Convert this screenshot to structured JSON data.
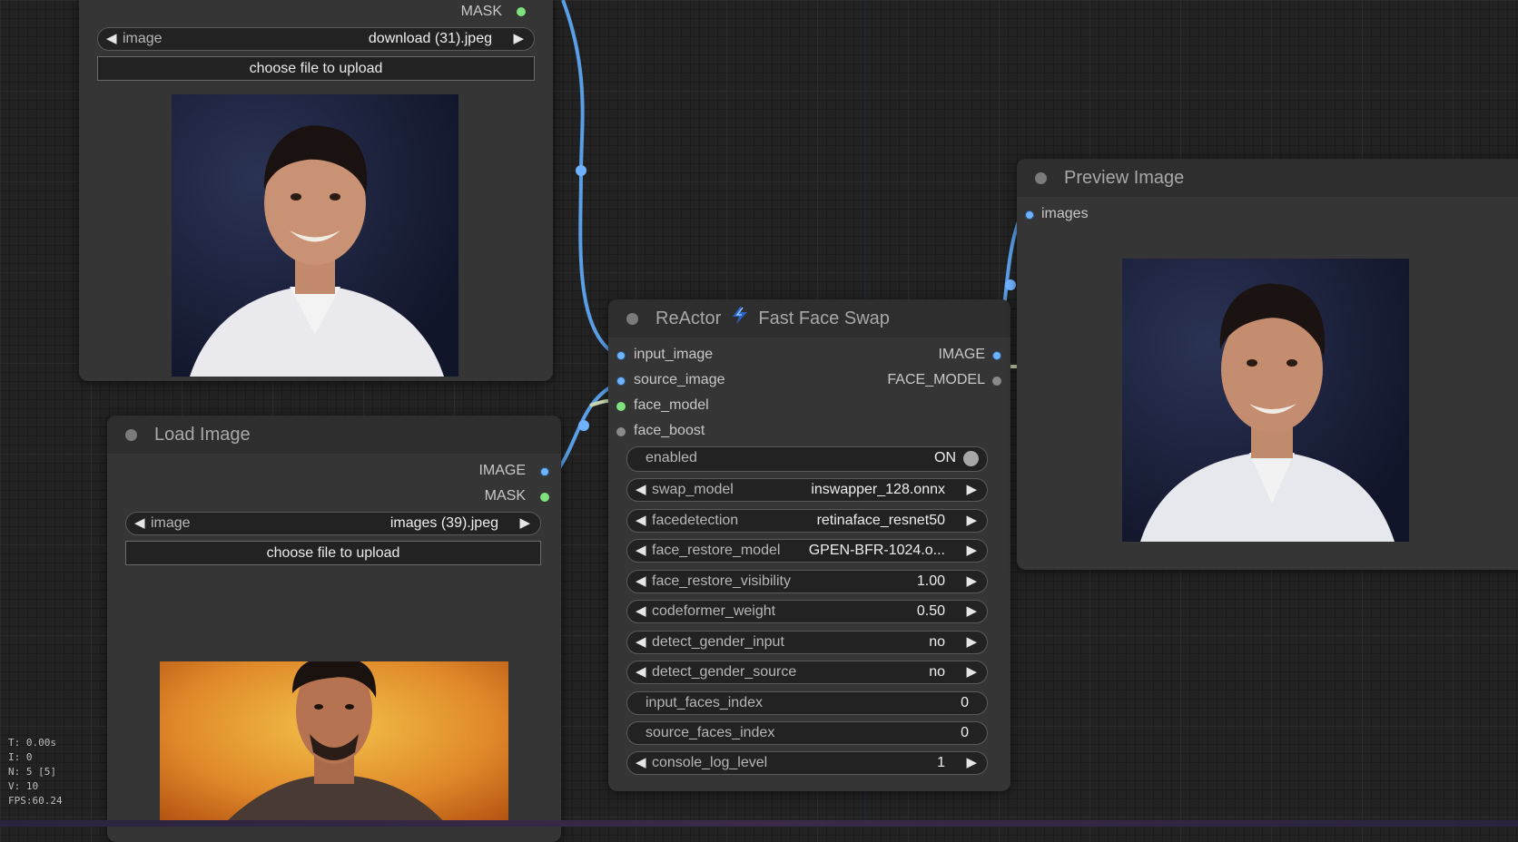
{
  "top_node": {
    "output_mask": "MASK",
    "image_widget": {
      "name": "image",
      "value": "download (31).jpeg"
    },
    "upload_label": "choose file to upload"
  },
  "load_node": {
    "title": "Load Image",
    "outputs": [
      "IMAGE",
      "MASK"
    ],
    "image_widget": {
      "name": "image",
      "value": "images (39).jpeg"
    },
    "upload_label": "choose file to upload"
  },
  "reactor_node": {
    "title_left": "ReActor",
    "title_right": "Fast Face Swap",
    "inputs": [
      "input_image",
      "source_image",
      "face_model",
      "face_boost"
    ],
    "outputs": [
      "IMAGE",
      "FACE_MODEL"
    ],
    "toggle": {
      "name": "enabled",
      "value": "ON"
    },
    "widgets": [
      {
        "name": "swap_model",
        "value": "inswapper_128.onnx"
      },
      {
        "name": "facedetection",
        "value": "retinaface_resnet50"
      },
      {
        "name": "face_restore_model",
        "value": "GPEN-BFR-1024.o..."
      },
      {
        "name": "face_restore_visibility",
        "value": "1.00"
      },
      {
        "name": "codeformer_weight",
        "value": "0.50"
      },
      {
        "name": "detect_gender_input",
        "value": "no"
      },
      {
        "name": "detect_gender_source",
        "value": "no"
      }
    ],
    "plain_widgets": [
      {
        "name": "input_faces_index",
        "value": "0"
      },
      {
        "name": "source_faces_index",
        "value": "0"
      }
    ],
    "last_widget": {
      "name": "console_log_level",
      "value": "1"
    }
  },
  "preview_node": {
    "title": "Preview Image",
    "input": "images"
  },
  "stats": {
    "t": "T: 0.00s",
    "i": "I: 0",
    "n": "N: 5 [5]",
    "v": "V: 10",
    "fps": "FPS:60.24"
  },
  "colors": {
    "link_image": "#6fb2ff",
    "link_face_model": "#c8d6b0",
    "slot_mask": "#7ee27e"
  }
}
